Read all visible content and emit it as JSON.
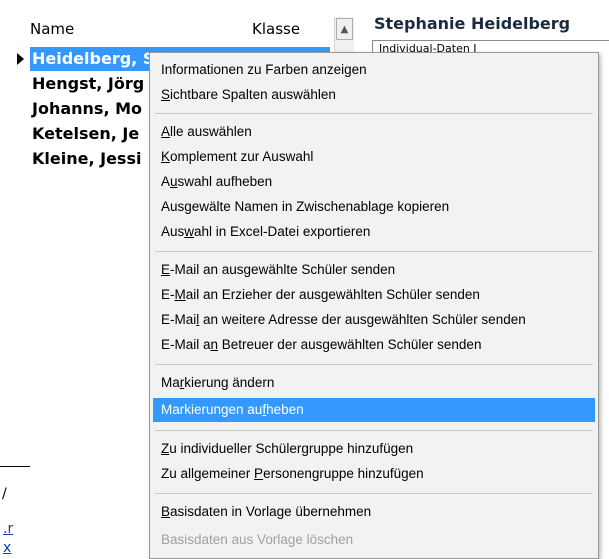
{
  "list": {
    "headers": {
      "name": "Name",
      "klasse": "Klasse"
    },
    "rows": [
      {
        "name": "Heidelberg, S"
      },
      {
        "name": "Hengst, Jörg"
      },
      {
        "name": "Johanns, Mo"
      },
      {
        "name": "Ketelsen, Je"
      },
      {
        "name": "Kleine, Jessi"
      }
    ]
  },
  "detail": {
    "title": "Stephanie Heidelberg",
    "tab_partial": "Individual-Daten I"
  },
  "background_bottom": {
    "slash": "/",
    "link1": ".r",
    "link2": "x"
  },
  "context_menu": {
    "items": [
      {
        "label": "Informationen zu Farben anzeigen",
        "underline": ""
      },
      {
        "label": "Sichtbare Spalten auswählen",
        "underline": "S"
      },
      {
        "label": "Alle auswählen",
        "underline": "A"
      },
      {
        "label": "Komplement zur Auswahl",
        "underline": "K"
      },
      {
        "label": "Auswahl aufheben",
        "underline": "u"
      },
      {
        "label": "Ausgewälte Namen in Zwischenablage kopieren",
        "underline": ""
      },
      {
        "label": "Auswahl in Excel-Datei exportieren",
        "underline": "w"
      },
      {
        "label": "E-Mail an ausgewählte Schüler senden",
        "underline": "E"
      },
      {
        "label": "E-Mail an Erzieher der ausgewählten Schüler senden",
        "underline": "M"
      },
      {
        "label": "E-Mail an weitere Adresse der ausgewählten Schüler senden",
        "underline": "l"
      },
      {
        "label": "E-Mail an Betreuer der ausgewählten Schüler senden",
        "underline": "n"
      },
      {
        "label": "Markierung ändern",
        "underline": "r"
      },
      {
        "label": "Markierungen aufheben",
        "underline": "f"
      },
      {
        "label": "Zu individueller Schülergruppe hinzufügen",
        "underline": "Z"
      },
      {
        "label": "Zu allgemeiner Personengruppe hinzufügen",
        "underline": "P"
      },
      {
        "label": "Basisdaten in Vorlage übernehmen",
        "underline": "B"
      },
      {
        "label": "Basisdaten aus Vorlage löschen",
        "underline": ""
      }
    ]
  }
}
